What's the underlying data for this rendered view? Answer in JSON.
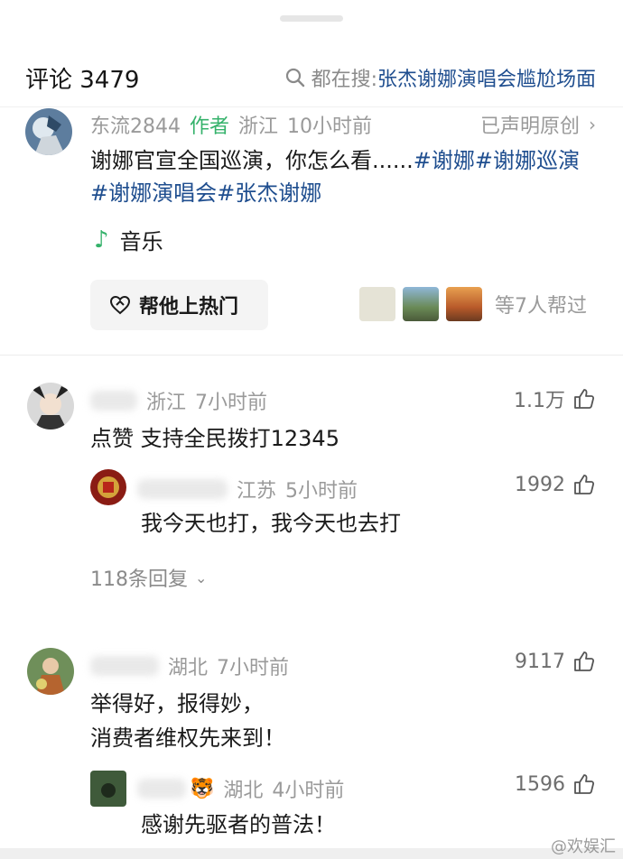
{
  "header": {
    "title": "评论 3479",
    "search_label": "都在搜:",
    "search_query": "张杰谢娜演唱会尴尬场面"
  },
  "author_post": {
    "name": "东流2844",
    "author_tag": "作者",
    "location": "浙江",
    "time": "10小时前",
    "claim": "已声明原创",
    "text_plain": "谢娜官宣全国巡演，你怎么看......",
    "tag1": "#谢娜",
    "tag2": "#谢娜巡演",
    "tag3": "#谢娜演唱会",
    "tag4": "#张杰谢娜",
    "music_label": "音乐",
    "hot_button": "帮他上热门",
    "helpers_count": "等7人帮过"
  },
  "comments": [
    {
      "location": "浙江",
      "time": "7小时前",
      "likes": "1.1万",
      "text": "点赞 支持全民拨打12345",
      "reply": {
        "location": "江苏",
        "time": "5小时前",
        "likes": "1992",
        "text": "我今天也打，我今天也去打"
      },
      "more_replies": "118条回复"
    },
    {
      "location": "湖北",
      "time": "7小时前",
      "likes": "9117",
      "text_line1": "举得好，报得妙，",
      "text_line2": "消费者维权先来到！",
      "reply": {
        "location": "湖北",
        "time": "4小时前",
        "likes": "1596",
        "text": "感谢先驱者的普法！"
      }
    }
  ],
  "watermark": "@欢娱汇",
  "colors": {
    "link": "#1f4e8f",
    "author_green": "#35b26b",
    "meta_gray": "#9a9a9a"
  }
}
